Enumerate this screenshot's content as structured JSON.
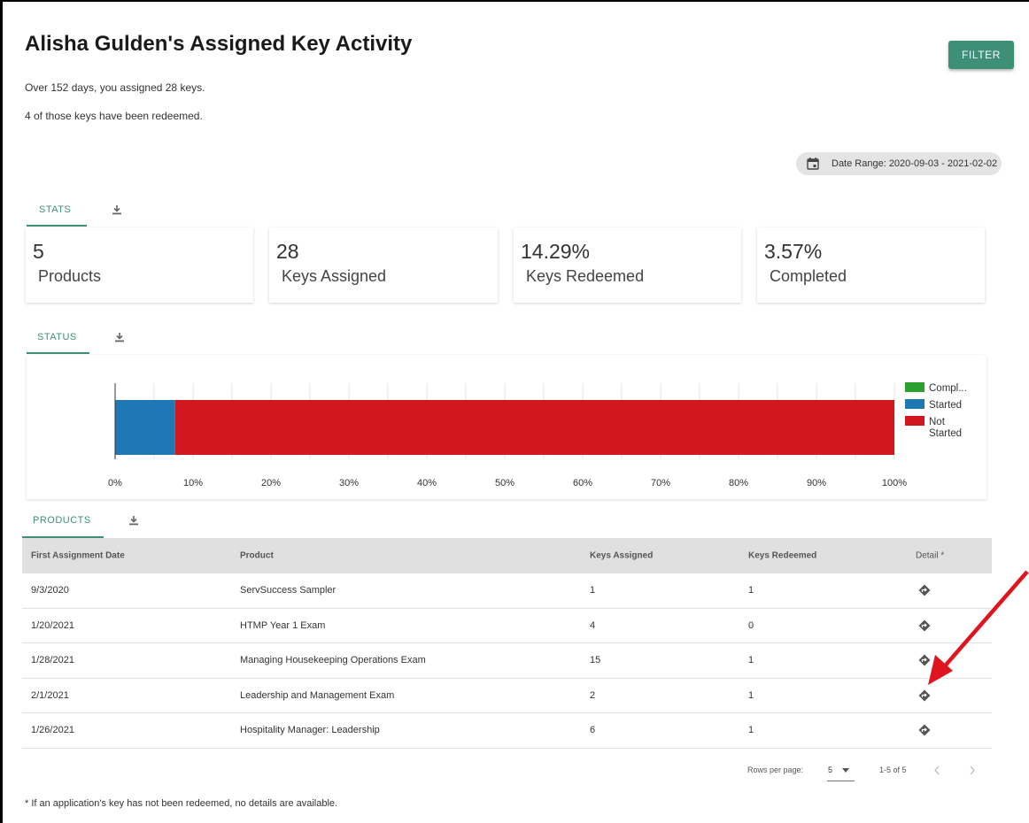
{
  "header": {
    "title": "Alisha Gulden's Assigned Key Activity",
    "summary_line1": "Over 152 days, you assigned 28 keys.",
    "summary_line2": "4 of those keys have been redeemed.",
    "filter_label": "FILTER",
    "date_range": "Date Range: 2020-09-03 - 2021-02-02"
  },
  "tabs": {
    "stats": "STATS",
    "status": "STATUS",
    "products": "PRODUCTS"
  },
  "stats": [
    {
      "value": "5",
      "label": "Products"
    },
    {
      "value": "28",
      "label": "Keys Assigned"
    },
    {
      "value": "14.29%",
      "label": "Keys Redeemed"
    },
    {
      "value": "3.57%",
      "label": "Completed"
    }
  ],
  "chart_data": {
    "type": "bar",
    "orientation": "horizontal",
    "stacked": true,
    "x_ticks": [
      "0%",
      "10%",
      "20%",
      "30%",
      "40%",
      "50%",
      "60%",
      "70%",
      "80%",
      "90%",
      "100%"
    ],
    "xlim": [
      0,
      100
    ],
    "grid": true,
    "legend_position": "right",
    "series": [
      {
        "name": "Compl...",
        "value": 0,
        "color": "#2ca02c"
      },
      {
        "name": "Started",
        "value": 7.7,
        "color": "#1f77b4"
      },
      {
        "name": "Not Started",
        "value": 92.3,
        "color": "#d0181e"
      }
    ]
  },
  "table": {
    "columns": [
      "First Assignment Date",
      "Product",
      "Keys Assigned",
      "Keys Redeemed",
      "Detail *"
    ],
    "rows": [
      [
        "9/3/2020",
        "ServSuccess Sampler",
        "1",
        "1"
      ],
      [
        "1/20/2021",
        "HTMP Year 1 Exam",
        "4",
        "0"
      ],
      [
        "1/28/2021",
        "Managing Housekeeping Operations Exam",
        "15",
        "1"
      ],
      [
        "2/1/2021",
        "Leadership and Management Exam",
        "2",
        "1"
      ],
      [
        "1/26/2021",
        "Hospitality Manager: Leadership",
        "6",
        "1"
      ]
    ]
  },
  "pagination": {
    "rows_per_page_label": "Rows per page:",
    "rows_per_page_value": "5",
    "range": "1-5 of 5"
  },
  "footnote": "* If an application's key has not been redeemed, no details are available.",
  "colors": {
    "accent": "#3d8f76",
    "annotation_arrow": "#e0141e"
  }
}
